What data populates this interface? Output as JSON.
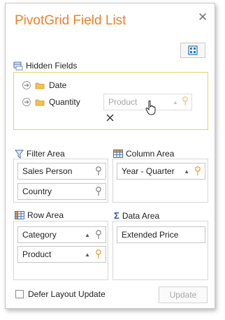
{
  "window": {
    "title": "PivotGrid Field List",
    "close_icon": "close-icon"
  },
  "toolbar": {
    "layout_icon": "layout-grid-icon"
  },
  "hidden_fields": {
    "label": "Hidden Fields",
    "items": [
      {
        "label": "Date",
        "icon": "folder-icon"
      },
      {
        "label": "Quantity",
        "icon": "folder-icon"
      }
    ],
    "drag_ghost": {
      "label": "Product"
    }
  },
  "filter_area": {
    "label": "Filter Area",
    "items": [
      {
        "label": "Sales Person"
      },
      {
        "label": "Country"
      }
    ]
  },
  "column_area": {
    "label": "Column Area",
    "items": [
      {
        "label": "Year - Quarter"
      }
    ]
  },
  "row_area": {
    "label": "Row Area",
    "items": [
      {
        "label": "Category"
      },
      {
        "label": "Product"
      }
    ]
  },
  "data_area": {
    "label": "Data Area",
    "items": [
      {
        "label": "Extended Price"
      }
    ]
  },
  "footer": {
    "defer_label": "Defer Layout Update",
    "defer_checked": false,
    "update_label": "Update"
  },
  "colors": {
    "accent": "#e9822a",
    "hidden_border": "#e6d070",
    "filter_active": "#f0a13a"
  }
}
